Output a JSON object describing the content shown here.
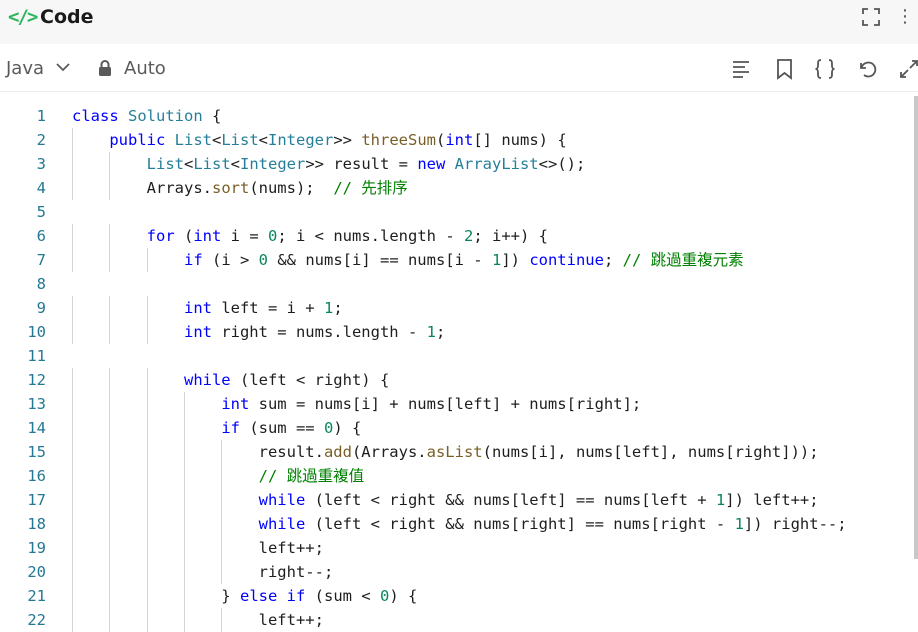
{
  "header": {
    "icon": "code-icon",
    "title": "Code"
  },
  "toolbar": {
    "language": "Java",
    "mode": "Auto"
  },
  "colors": {
    "keyword": "#0000ff",
    "type": "#267f99",
    "function": "#795e26",
    "number": "#098658",
    "comment": "#008000",
    "line_number": "#237893",
    "accent": "#2db55d"
  },
  "code": {
    "lines": [
      [
        {
          "t": "class",
          "c": "kw"
        },
        {
          "t": " "
        },
        {
          "t": "Solution",
          "c": "ty"
        },
        {
          "t": " {"
        }
      ],
      [
        {
          "t": "    "
        },
        {
          "t": "public",
          "c": "kw"
        },
        {
          "t": " "
        },
        {
          "t": "List",
          "c": "ty"
        },
        {
          "t": "<"
        },
        {
          "t": "List",
          "c": "ty"
        },
        {
          "t": "<"
        },
        {
          "t": "Integer",
          "c": "ty"
        },
        {
          "t": ">> "
        },
        {
          "t": "threeSum",
          "c": "fn"
        },
        {
          "t": "("
        },
        {
          "t": "int",
          "c": "kw"
        },
        {
          "t": "[] nums) {"
        }
      ],
      [
        {
          "t": "        "
        },
        {
          "t": "List",
          "c": "ty"
        },
        {
          "t": "<"
        },
        {
          "t": "List",
          "c": "ty"
        },
        {
          "t": "<"
        },
        {
          "t": "Integer",
          "c": "ty"
        },
        {
          "t": ">> result = "
        },
        {
          "t": "new",
          "c": "kw"
        },
        {
          "t": " "
        },
        {
          "t": "ArrayList",
          "c": "ty"
        },
        {
          "t": "<>();"
        }
      ],
      [
        {
          "t": "        Arrays."
        },
        {
          "t": "sort",
          "c": "fn"
        },
        {
          "t": "(nums);  "
        },
        {
          "t": "// 先排序",
          "c": "cm"
        }
      ],
      [
        {
          "t": ""
        }
      ],
      [
        {
          "t": "        "
        },
        {
          "t": "for",
          "c": "kw"
        },
        {
          "t": " ("
        },
        {
          "t": "int",
          "c": "kw"
        },
        {
          "t": " i = "
        },
        {
          "t": "0",
          "c": "num"
        },
        {
          "t": "; i < nums.length - "
        },
        {
          "t": "2",
          "c": "num"
        },
        {
          "t": "; i++) {"
        }
      ],
      [
        {
          "t": "            "
        },
        {
          "t": "if",
          "c": "kw"
        },
        {
          "t": " (i > "
        },
        {
          "t": "0",
          "c": "num"
        },
        {
          "t": " && nums[i] == nums[i - "
        },
        {
          "t": "1",
          "c": "num"
        },
        {
          "t": "]) "
        },
        {
          "t": "continue",
          "c": "kw"
        },
        {
          "t": "; "
        },
        {
          "t": "// 跳過重複元素",
          "c": "cm"
        }
      ],
      [
        {
          "t": ""
        }
      ],
      [
        {
          "t": "            "
        },
        {
          "t": "int",
          "c": "kw"
        },
        {
          "t": " left = i + "
        },
        {
          "t": "1",
          "c": "num"
        },
        {
          "t": ";"
        }
      ],
      [
        {
          "t": "            "
        },
        {
          "t": "int",
          "c": "kw"
        },
        {
          "t": " right = nums.length - "
        },
        {
          "t": "1",
          "c": "num"
        },
        {
          "t": ";"
        }
      ],
      [
        {
          "t": ""
        }
      ],
      [
        {
          "t": "            "
        },
        {
          "t": "while",
          "c": "kw"
        },
        {
          "t": " (left < right) {"
        }
      ],
      [
        {
          "t": "                "
        },
        {
          "t": "int",
          "c": "kw"
        },
        {
          "t": " sum = nums[i] + nums[left] + nums[right];"
        }
      ],
      [
        {
          "t": "                "
        },
        {
          "t": "if",
          "c": "kw"
        },
        {
          "t": " (sum == "
        },
        {
          "t": "0",
          "c": "num"
        },
        {
          "t": ") {"
        }
      ],
      [
        {
          "t": "                    result."
        },
        {
          "t": "add",
          "c": "fn"
        },
        {
          "t": "(Arrays."
        },
        {
          "t": "asList",
          "c": "fn"
        },
        {
          "t": "(nums[i], nums[left], nums[right]));"
        }
      ],
      [
        {
          "t": "                    "
        },
        {
          "t": "// 跳過重複值",
          "c": "cm"
        }
      ],
      [
        {
          "t": "                    "
        },
        {
          "t": "while",
          "c": "kw"
        },
        {
          "t": " (left < right && nums[left] == nums[left + "
        },
        {
          "t": "1",
          "c": "num"
        },
        {
          "t": "]) left++;"
        }
      ],
      [
        {
          "t": "                    "
        },
        {
          "t": "while",
          "c": "kw"
        },
        {
          "t": " (left < right && nums[right] == nums[right - "
        },
        {
          "t": "1",
          "c": "num"
        },
        {
          "t": "]) right--;"
        }
      ],
      [
        {
          "t": "                    left++;"
        }
      ],
      [
        {
          "t": "                    right--;"
        }
      ],
      [
        {
          "t": "                } "
        },
        {
          "t": "else",
          "c": "kw"
        },
        {
          "t": " "
        },
        {
          "t": "if",
          "c": "kw"
        },
        {
          "t": " (sum < "
        },
        {
          "t": "0",
          "c": "num"
        },
        {
          "t": ") {"
        }
      ],
      [
        {
          "t": "                    left++;"
        }
      ]
    ]
  }
}
